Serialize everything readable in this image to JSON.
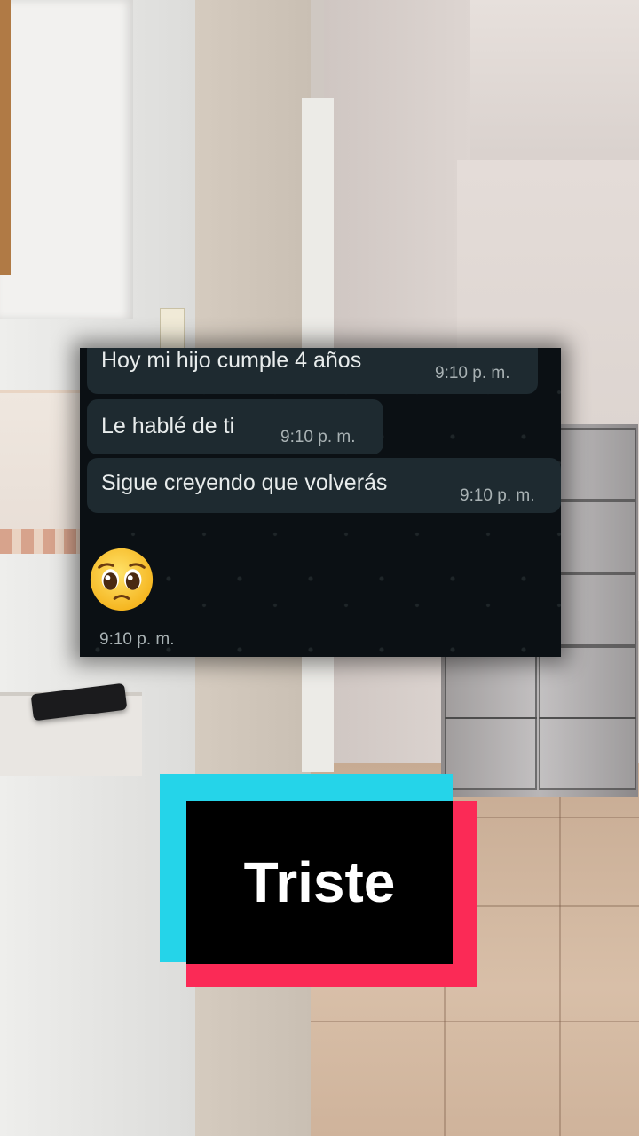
{
  "chat": {
    "messages": [
      {
        "text": "Hoy mi hijo cumple 4 años",
        "time": "9:10 p. m."
      },
      {
        "text": "Le hablé de ti",
        "time": "9:10 p. m."
      },
      {
        "text": "Sigue creyendo que volverás",
        "time": "9:10 p. m."
      }
    ],
    "emoji_message": {
      "emoji": "pleading-face-icon",
      "time": "9:10 p. m."
    }
  },
  "sticker": {
    "text": "Triste"
  },
  "colors": {
    "bubble": "#1e2a30",
    "chat_bg": "#0b1014",
    "sticker_cyan": "#25d4e9",
    "sticker_pink": "#fb2a56"
  }
}
